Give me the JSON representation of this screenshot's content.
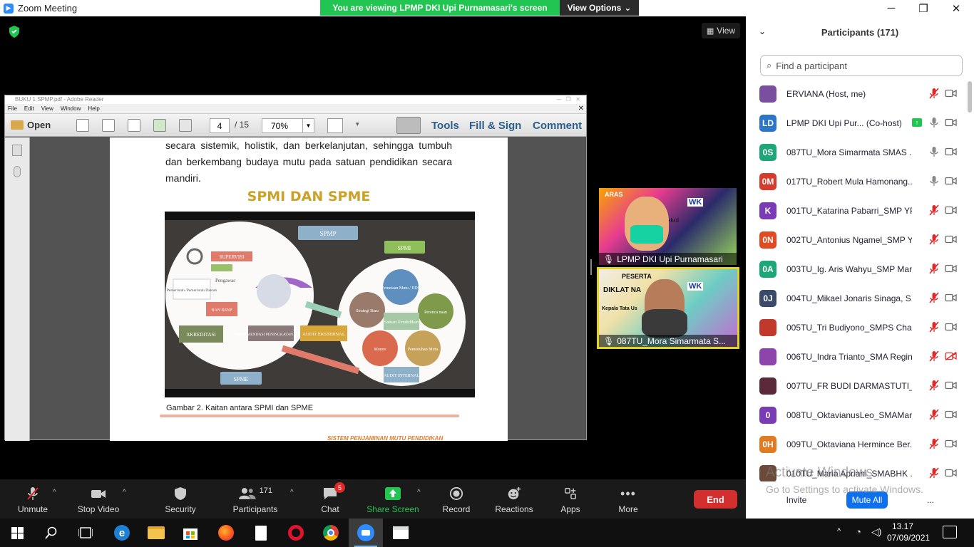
{
  "window": {
    "title": "Zoom Meeting",
    "controls": [
      "minimize",
      "restore",
      "close"
    ]
  },
  "share_banner": {
    "message": "You are viewing LPMP DKI Upi Purnamasari's screen",
    "options_label": "View Options"
  },
  "view_button": {
    "label": "View"
  },
  "reader": {
    "title": "BUKU 1 SPMP.pdf - Adobe Reader",
    "menu": [
      "File",
      "Edit",
      "View",
      "Window",
      "Help"
    ],
    "open_label": "Open",
    "page_current": "4",
    "page_total": "/ 15",
    "zoom": "70%",
    "links": [
      "Tools",
      "Fill & Sign",
      "Comment"
    ],
    "page": {
      "body_text": "secara sistemik, holistik, dan berkelanjutan, sehingga tumbuh dan berkembang budaya mutu pada satuan pendidikan secara mandiri.",
      "heading": "SPMI DAN SPME",
      "caption": "Gambar 2. Kaitan antara SPMI dan SPME",
      "footer": "SISTEM PENJAMINAN MUTU PENDIDIKAN",
      "diagram": {
        "spmp": "SPMP",
        "spmi": "SPMI",
        "spme": "SPME",
        "supervisi": "SUPERVISI",
        "pengawas": "Pengawas",
        "pemerintah": "Pemerintah /Pemerintah Daerah",
        "ban": "BAN BSNP",
        "akreditasi": "AKREDITASI",
        "rekomendasi": "REKOMENDASI PENINGKATAN MUTU",
        "audit_eksternal": "AUDIT EKSTERNAL",
        "audit_internal": "AUDIT INTERNAL",
        "pemetaan": "Pemetaan Mutu / EDS",
        "perencanaan": "Perenca naan",
        "pemenuhan": "Pemenuhan Mutu",
        "monev": "Monev",
        "strategi": "Strategi Baru",
        "satuan": "Satuan Pendidikan"
      }
    }
  },
  "videos": [
    {
      "name": "LPMP DKI Upi Purnamasari",
      "overlay": [
        "ARAS",
        "WK",
        "a Sekol"
      ]
    },
    {
      "name": "087TU_Mora Simarmata S...",
      "overlay": [
        "PESERTA",
        "DIKLAT NA",
        "Kepala Tata Us",
        "WK"
      ]
    }
  ],
  "toolbar": {
    "unmute": "Unmute",
    "stop_video": "Stop Video",
    "security": "Security",
    "participants": "Participants",
    "participants_count": "171",
    "chat": "Chat",
    "chat_badge": "5",
    "share_screen": "Share Screen",
    "record": "Record",
    "reactions": "Reactions",
    "apps": "Apps",
    "more": "More",
    "end": "End"
  },
  "panel": {
    "title": "Participants (171)",
    "search_placeholder": "Find a participant",
    "participants": [
      {
        "initials": "",
        "name": "ERVIANA (Host, me)",
        "avatar_color": "#7a4fa0",
        "mic": "muted",
        "cam": "off"
      },
      {
        "initials": "LD",
        "name": "LPMP DKI Upi Pur... (Co-host)",
        "avatar_color": "#2d75c9",
        "mic": "on",
        "cam": "off",
        "sharing": true
      },
      {
        "initials": "0S",
        "name": "087TU_Mora Simarmata SMAS ...",
        "avatar_color": "#1da678",
        "mic": "on",
        "cam": "off"
      },
      {
        "initials": "0M",
        "name": "017TU_Robert Mula Hamonang...",
        "avatar_color": "#d53c2e",
        "mic": "on",
        "cam": "off"
      },
      {
        "initials": "K",
        "name": "001TU_Katarina Pabarri_SMP YP...",
        "avatar_color": "#7b3bb5",
        "mic": "muted",
        "cam": "off"
      },
      {
        "initials": "0N",
        "name": "002TU_Antonius Ngamel_SMP Y...",
        "avatar_color": "#e14b22",
        "mic": "muted",
        "cam": "off"
      },
      {
        "initials": "0A",
        "name": "003TU_Ig. Aris Wahyu_SMP Mari...",
        "avatar_color": "#1da678",
        "mic": "muted",
        "cam": "off"
      },
      {
        "initials": "0J",
        "name": "004TU_Mikael Jonaris Sinaga, S...",
        "avatar_color": "#3a4a6b",
        "mic": "muted",
        "cam": "off"
      },
      {
        "initials": "",
        "name": "005TU_Tri Budiyono_SMPS Chari...",
        "avatar_color": "#c0392b",
        "mic": "muted",
        "cam": "off"
      },
      {
        "initials": "",
        "name": "006TU_Indra Trianto_SMA Regin...",
        "avatar_color": "#8e44ad",
        "mic": "muted",
        "cam": "muted"
      },
      {
        "initials": "",
        "name": "007TU_FR BUDI DARMASTUTI_S...",
        "avatar_color": "#5a2a3a",
        "mic": "muted",
        "cam": "off"
      },
      {
        "initials": "0",
        "name": "008TU_OktavianusLeo_SMAMar...",
        "avatar_color": "#7b3bb5",
        "mic": "muted",
        "cam": "off"
      },
      {
        "initials": "0H",
        "name": "009TU_Oktaviana Hermince Ber...",
        "avatar_color": "#e17b22",
        "mic": "muted",
        "cam": "off"
      },
      {
        "initials": "",
        "name": "010TU_Maria Apriani_SMABHK ...",
        "avatar_color": "#6b4a3a",
        "mic": "muted",
        "cam": "off"
      }
    ],
    "invite": "Invite",
    "mute_all": "Mute All",
    "more": "..."
  },
  "watermark": {
    "line1": "Activate Windows",
    "line2": "Go to Settings to activate Windows."
  },
  "taskbar": {
    "time": "13.17",
    "date": "07/09/2021"
  },
  "colors": {
    "zoom_blue": "#2d8cff",
    "share_green": "#23c552",
    "end_red": "#d32f2f",
    "heading_gold": "#c9a227"
  }
}
